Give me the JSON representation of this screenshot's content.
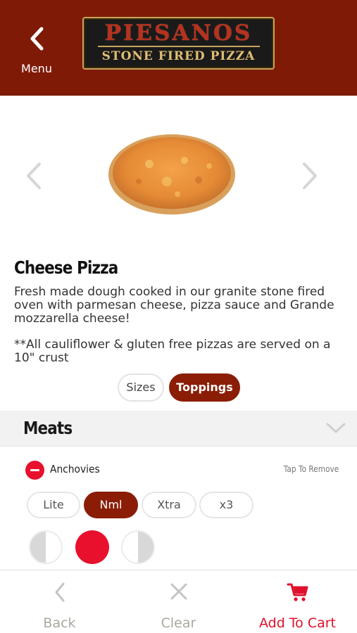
{
  "header": {
    "menu_label": "Menu",
    "logo_line1": "PIESANOS",
    "logo_line2": "STONE FIRED PIZZA"
  },
  "item": {
    "title": "Cheese Pizza",
    "description": "Fresh made dough cooked in our granite stone fired oven with parmesan cheese, pizza sauce and Grande mozzarella cheese!",
    "note": "**All cauliflower & gluten free pizzas are served on a 10\" crust"
  },
  "segments": {
    "sizes": "Sizes",
    "toppings": "Toppings",
    "selected": "Toppings"
  },
  "category": {
    "title": "Meats"
  },
  "topping": {
    "name": "Anchovies",
    "action_hint": "Tap To Remove",
    "amounts": [
      "Lite",
      "Nml",
      "Xtra",
      "x3"
    ],
    "selected_amount": "Nml",
    "placement_selected": "whole"
  },
  "bottom_bar": {
    "back": "Back",
    "clear": "Clear",
    "add_to_cart": "Add To Cart"
  },
  "colors": {
    "brand": "#7f1a07",
    "accent_red": "#e8102d",
    "selected_pill": "#8b1d07"
  },
  "icons": {
    "menu": "chevron-left-icon",
    "carousel_prev": "chevron-left-icon",
    "carousel_next": "chevron-right-icon",
    "category_toggle": "chevron-down-icon",
    "remove": "minus-circle-icon",
    "back": "chevron-left-icon",
    "clear": "close-icon",
    "cart": "cart-icon"
  }
}
